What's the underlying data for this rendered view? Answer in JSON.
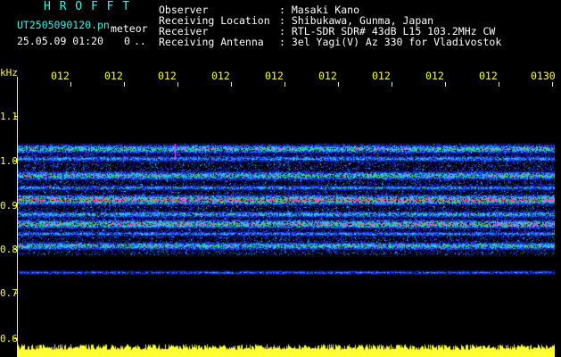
{
  "header": {
    "station_title": "H R O F F T",
    "filename": "UT2505090120.pn",
    "mode": "meteor",
    "datetime": "25.05.09 01:20",
    "count": "0",
    "count_suffix": "..",
    "fields": [
      {
        "key": "Observer",
        "value": ": Masaki Kano"
      },
      {
        "key": "Receiving Location",
        "value": ": Shibukawa, Gunma, Japan"
      },
      {
        "key": "Receiver",
        "value": ": RTL-SDR SDR# 43dB L15 103.2MHz CW"
      },
      {
        "key": "Receiving Antenna",
        "value": ": 3el Yagi(V) Az 330 for Vladivostok"
      }
    ]
  },
  "axis": {
    "y_unit": "kHz",
    "y_labels": [
      "1.1",
      "1.0",
      "0.9",
      "0.8",
      "0.7",
      "0.6"
    ],
    "time_labels": [
      "012",
      "012",
      "012",
      "012",
      "012",
      "012",
      "012",
      "012",
      "012",
      "0130"
    ]
  },
  "colors": {
    "text_cyan": "#3ff0e6",
    "text_white": "#ffffff",
    "axis_yellow": "#ffff33",
    "signal_red": "#ff3030",
    "signal_green": "#30e060",
    "signal_blue": "#2040ff",
    "background": "#000000"
  },
  "spectrogram": {
    "frequency_range_khz": [
      0.58,
      1.14
    ],
    "bands": [
      {
        "center_khz": 1.01,
        "width_khz": 0.008,
        "intensity": 0.75
      },
      {
        "center_khz": 0.99,
        "width_khz": 0.006,
        "intensity": 0.55
      },
      {
        "center_khz": 0.955,
        "width_khz": 0.008,
        "intensity": 0.75
      },
      {
        "center_khz": 0.93,
        "width_khz": 0.005,
        "intensity": 0.55
      },
      {
        "center_khz": 0.905,
        "width_khz": 0.009,
        "intensity": 0.95
      },
      {
        "center_khz": 0.875,
        "width_khz": 0.006,
        "intensity": 0.65
      },
      {
        "center_khz": 0.855,
        "width_khz": 0.008,
        "intensity": 0.85
      },
      {
        "center_khz": 0.835,
        "width_khz": 0.005,
        "intensity": 0.55
      },
      {
        "center_khz": 0.81,
        "width_khz": 0.007,
        "intensity": 0.75
      },
      {
        "center_khz": 0.755,
        "width_khz": 0.004,
        "intensity": 0.45
      }
    ],
    "noise_floor_range_khz": [
      0.79,
      1.02
    ],
    "bottom_fill_khz": 0.595
  }
}
